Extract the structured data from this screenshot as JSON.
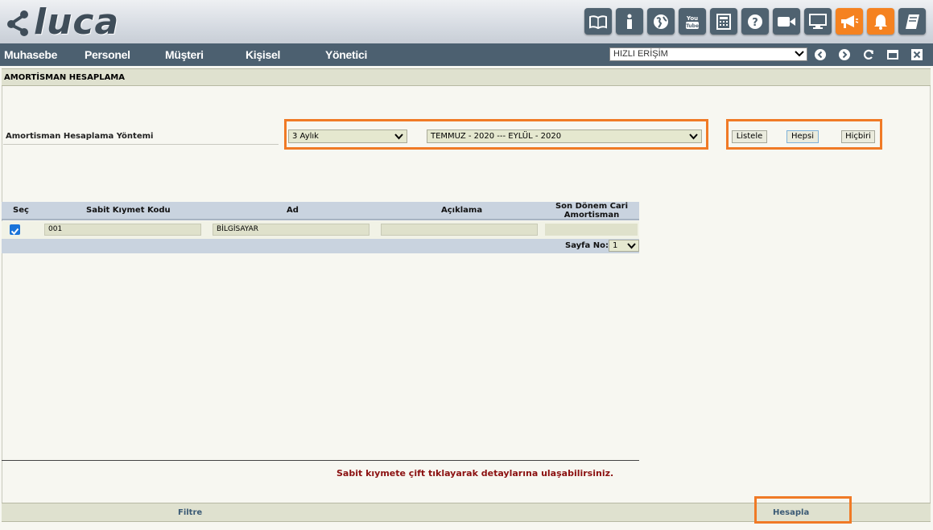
{
  "app": {
    "logo_text": "luca"
  },
  "toolbar_icons": [
    {
      "icon": "book-icon",
      "color": "#4f6270"
    },
    {
      "icon": "info-icon",
      "color": "#4f6270"
    },
    {
      "icon": "globe-icon",
      "color": "#4f6270"
    },
    {
      "icon": "youtube-icon",
      "color": "#4f6270"
    },
    {
      "icon": "calculator-icon",
      "color": "#4f6270"
    },
    {
      "icon": "help-icon",
      "color": "#4f6270"
    },
    {
      "icon": "video-camera-icon",
      "color": "#4f6270"
    },
    {
      "icon": "monitor-icon",
      "color": "#4f6270"
    },
    {
      "icon": "megaphone-icon",
      "color": "#f58220"
    },
    {
      "icon": "bell-icon",
      "color": "#f58220"
    },
    {
      "icon": "notebook-icon",
      "color": "#4f6270"
    }
  ],
  "menu": {
    "items": [
      "Muhasebe",
      "Personel",
      "Müşteri",
      "Kişisel",
      "Yönetici"
    ],
    "quick_access": "HIZLI ERİŞİM"
  },
  "page": {
    "title": "AMORTİSMAN HESAPLAMA",
    "method_label": "Amortisman Hesaplama Yöntemi",
    "period_select": "3 Aylık",
    "date_range_select": "TEMMUZ - 2020 --- EYLÜL - 2020",
    "buttons": {
      "list": "Listele",
      "all": "Hepsi",
      "none": "Hiçbiri"
    }
  },
  "grid": {
    "headers": {
      "select": "Seç",
      "code": "Sabit Kıymet Kodu",
      "name": "Ad",
      "description": "Açıklama",
      "last_period_line1": "Son Dönem Cari",
      "last_period_line2": "Amortisman"
    },
    "rows": [
      {
        "checked": true,
        "code": "001",
        "name": "BİLGİSAYAR",
        "description": "",
        "last_period": ""
      }
    ],
    "pager_label": "Sayfa No:",
    "page_number": "1"
  },
  "info_text": "Sabit kıymete çift tıklayarak detaylarına ulaşabilirsiniz.",
  "footer": {
    "filter": "Filtre",
    "calculate": "Hesapla"
  },
  "colors": {
    "accent_orange": "#f07a26",
    "menubar": "#4c6070",
    "info_red": "#8b1010"
  }
}
